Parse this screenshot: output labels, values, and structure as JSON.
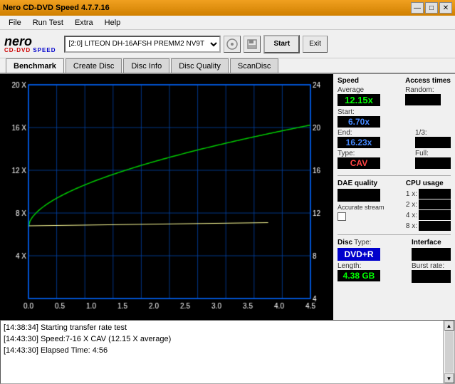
{
  "window": {
    "title": "Nero CD-DVD Speed 4.7.7.16",
    "title_bar_buttons": [
      "—",
      "□",
      "✕"
    ]
  },
  "menu": {
    "items": [
      "File",
      "Run Test",
      "Extra",
      "Help"
    ]
  },
  "toolbar": {
    "drive_label": "[2:0]  LITEON DH-16AFSH PREMM2 NV9T",
    "start_button": "Start",
    "exit_button": "Exit"
  },
  "tabs": [
    {
      "label": "Benchmark",
      "active": true
    },
    {
      "label": "Create Disc",
      "active": false
    },
    {
      "label": "Disc Info",
      "active": false
    },
    {
      "label": "Disc Quality",
      "active": false
    },
    {
      "label": "ScanDisc",
      "active": false
    }
  ],
  "chart": {
    "y_axis_left": [
      "20 X",
      "16 X",
      "12 X",
      "8 X",
      "4 X"
    ],
    "y_axis_right": [
      "24",
      "20",
      "16",
      "12",
      "8",
      "4"
    ],
    "x_axis": [
      "0.0",
      "0.5",
      "1.0",
      "1.5",
      "2.0",
      "2.5",
      "3.0",
      "3.5",
      "4.0",
      "4.5"
    ]
  },
  "speed_panel": {
    "title": "Speed",
    "average_label": "Average",
    "average_value": "12.15x",
    "start_label": "Start:",
    "start_value": "6.70x",
    "end_label": "End:",
    "end_value": "16.23x",
    "type_label": "Type:",
    "type_value": "CAV"
  },
  "access_times": {
    "title": "Access times",
    "random_label": "Random:",
    "onethird_label": "1/3:",
    "full_label": "Full:"
  },
  "dae_quality": {
    "title": "DAE quality",
    "accurate_stream_label": "Accurate stream"
  },
  "cpu_usage": {
    "title": "CPU usage",
    "labels": [
      "1 x:",
      "2 x:",
      "4 x:",
      "8 x:"
    ]
  },
  "disc_info": {
    "type_title": "Disc",
    "type_subtitle": "Type:",
    "type_value": "DVD+R",
    "length_title": "Length:",
    "length_value": "4.38 GB"
  },
  "interface": {
    "title": "Interface",
    "burst_rate_title": "Burst rate:"
  },
  "log": {
    "lines": [
      {
        "time": "[14:38:34]",
        "text": "Starting transfer rate test"
      },
      {
        "time": "[14:43:30]",
        "text": "Speed:7-16 X CAV (12.15 X average)"
      },
      {
        "time": "[14:43:30]",
        "text": "Elapsed Time: 4:56"
      }
    ]
  }
}
